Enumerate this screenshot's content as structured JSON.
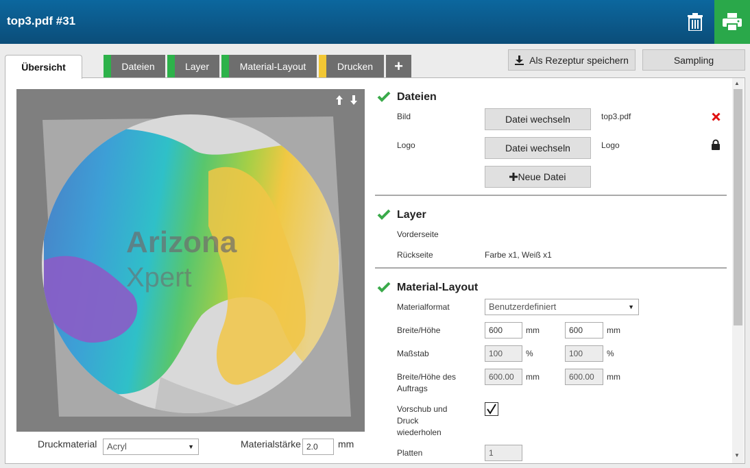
{
  "app": {
    "title": "top3.pdf #31"
  },
  "header": {
    "trash_icon": "trash-icon",
    "print_icon": "printer-icon"
  },
  "tabs": [
    {
      "label": "Übersicht",
      "active": true
    },
    {
      "label": "Dateien",
      "accent": "#2db24a"
    },
    {
      "label": "Layer",
      "accent": "#2db24a"
    },
    {
      "label": "Material-Layout",
      "accent": "#2db24a"
    },
    {
      "label": "Drucken",
      "accent": "#f2c734"
    },
    {
      "label": "+"
    }
  ],
  "actions": {
    "save_recipe": "Als Rezeptur speichern",
    "sampling": "Sampling"
  },
  "preview": {
    "brand_line1": "Arizona",
    "brand_line2": "Xpert",
    "material_label": "Druckmaterial",
    "material_value": "Acryl",
    "thickness_label": "Materialstärke",
    "thickness_value": "2.0",
    "thickness_unit": "mm"
  },
  "dateien": {
    "title": "Dateien",
    "bild_label": "Bild",
    "bild_button": "Datei wechseln",
    "bild_file": "top3.pdf",
    "logo_label": "Logo",
    "logo_button": "Datei wechseln",
    "logo_file": "Logo",
    "new_file_button": "Neue Datei"
  },
  "layer": {
    "title": "Layer",
    "front_label": "Vorderseite",
    "front_value": "",
    "back_label": "Rückseite",
    "back_value": "Farbe x1, Weiß x1"
  },
  "material_layout": {
    "title": "Material-Layout",
    "format_label": "Materialformat",
    "format_value": "Benutzerdefiniert",
    "size_label": "Breite/Höhe",
    "width": "600",
    "height": "600",
    "unit_mm": "mm",
    "scale_label": "Maßstab",
    "scale_x": "100",
    "scale_y": "100",
    "unit_pct": "%",
    "job_size_label": "Breite/Höhe des Auftrags",
    "job_width": "600.00",
    "job_height": "600.00",
    "repeat_label": "Vorschub und Druck wiederholen",
    "repeat_checked": true,
    "plates_label": "Platten",
    "plates_value": "1"
  }
}
